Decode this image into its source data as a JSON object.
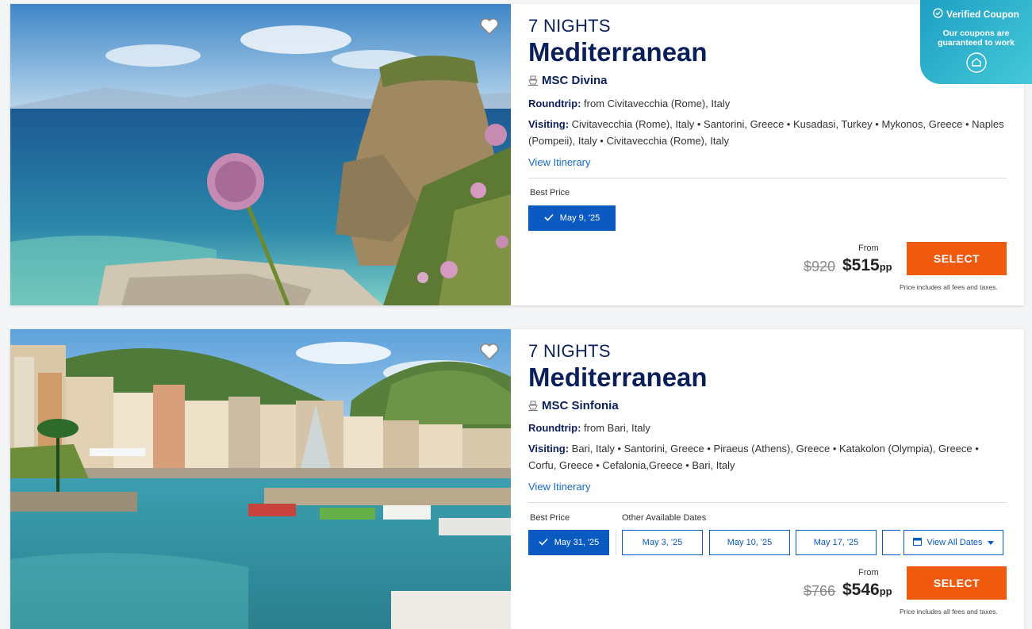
{
  "coupon": {
    "title": "Verified Coupon",
    "subtitle": "Our coupons are guaranteed to work"
  },
  "cruises": [
    {
      "nights": "7 NIGHTS",
      "destination": "Mediterranean",
      "ship": "MSC Divina",
      "roundtrip_label": "Roundtrip:",
      "roundtrip": " from Civitavecchia (Rome), Italy",
      "visiting_label": "Visiting:",
      "visiting_line1": " Civitavecchia (Rome), Italy • Santorini, Greece • Kusadasi, Turkey • Mykonos, Greece • Naples",
      "visiting_line2": "(Pompeii), Italy • Civitavecchia (Rome), Italy",
      "view_itinerary": "View Itinerary",
      "best_price_label": "Best Price",
      "best_price_date": "May 9, '25",
      "from_label": "From",
      "old_price": "$920",
      "new_price": "$515",
      "pp": "pp",
      "select_label": "SELECT",
      "fees_note": "Price includes all fees and taxes."
    },
    {
      "nights": "7 NIGHTS",
      "destination": "Mediterranean",
      "ship": "MSC Sinfonia",
      "roundtrip_label": "Roundtrip:",
      "roundtrip": " from Bari, Italy",
      "visiting_label": "Visiting:",
      "visiting_line1": " Bari, Italy • Santorini, Greece • Piraeus (Athens), Greece • Katakolon (Olympia), Greece •",
      "visiting_line2": "Corfu, Greece • Cefalonia,Greece • Bari, Italy",
      "view_itinerary": "View Itinerary",
      "best_price_label": "Best Price",
      "best_price_date": "May 31, '25",
      "other_dates_label": "Other Available Dates",
      "other_dates": [
        "May 3, '25",
        "May 10, '25",
        "May 17, '25"
      ],
      "view_all_dates": "View All Dates",
      "from_label": "From",
      "old_price": "$766",
      "new_price": "$546",
      "pp": "pp",
      "select_label": "SELECT",
      "fees_note": "Price includes all fees and taxes."
    }
  ],
  "icons": {
    "favorite": "heart-icon",
    "ship": "ship-icon",
    "check": "check-icon",
    "calendar": "calendar-icon",
    "caret": "caret-down-icon",
    "verified": "check-circle-icon",
    "coupon_badge": "tag-icon"
  },
  "colors": {
    "navy": "#0b1f5b",
    "blue": "#0a5ac2",
    "orange": "#f05a0e",
    "link": "#1769c5",
    "coupon": "#1e9fc4"
  }
}
